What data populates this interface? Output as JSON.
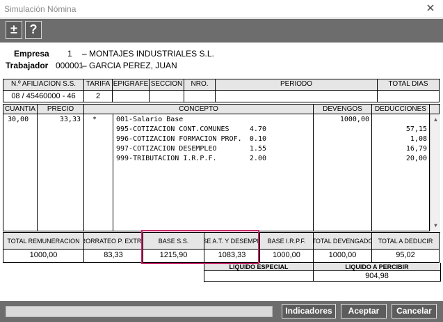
{
  "window": {
    "title": "Simulación Nómina",
    "close_glyph": "✕"
  },
  "toolbar": {
    "plusminus": "±",
    "help": "?"
  },
  "header": {
    "empresa_label": "Empresa",
    "empresa_code": "1",
    "empresa_name": "– MONTAJES INDUSTRIALES S.L.",
    "trabajador_label": "Trabajador",
    "trabajador_code": "000001",
    "trabajador_name": "– GARCIA PEREZ, JUAN"
  },
  "affiliation": {
    "headers": [
      "N.º AFILIACION S.S.",
      "TARIFA",
      "EPIGRAFE",
      "SECCION",
      "NRO.",
      "PERIODO",
      "TOTAL DIAS"
    ],
    "values": [
      "08 / 45460000 - 46",
      "2",
      "",
      "",
      "",
      "",
      ""
    ]
  },
  "lines": {
    "headers": {
      "cuantia": "CUANTIA",
      "precio": "PRECIO",
      "concepto": "CONCEPTO",
      "devengos": "DEVENGOS",
      "deducciones": "DEDUCCIONES"
    },
    "rows": [
      {
        "cuantia": "30,00",
        "precio": "33,33",
        "flag": "*",
        "concepto": "001-Salario Base",
        "pct": "",
        "devengos": "1000,00",
        "deducciones": ""
      },
      {
        "cuantia": "",
        "precio": "",
        "flag": "",
        "concepto": "995-COTIZACION CONT.COMUNES",
        "pct": "4.70",
        "devengos": "",
        "deducciones": "57,15"
      },
      {
        "cuantia": "",
        "precio": "",
        "flag": "",
        "concepto": "996-COTIZACION FORMACION PROF.",
        "pct": "0.10",
        "devengos": "",
        "deducciones": "1,08"
      },
      {
        "cuantia": "",
        "precio": "",
        "flag": "",
        "concepto": "997-COTIZACION DESEMPLEO",
        "pct": "1.55",
        "devengos": "",
        "deducciones": "16,79"
      },
      {
        "cuantia": "",
        "precio": "",
        "flag": "",
        "concepto": "999-TRIBUTACION I.R.P.F.",
        "pct": "2.00",
        "devengos": "",
        "deducciones": "20,00"
      }
    ]
  },
  "scrollbar": {
    "up": "▲",
    "down": "▼"
  },
  "totals": {
    "total_remuneracion_label": "TOTAL REMUNERACION",
    "prorrateo_label": "PRORRATEO P. EXTRAS",
    "base_ss_label": "BASE S.S.",
    "base_at_label": "BASE A.T. Y DESEMPLEO",
    "base_irpf_label": "BASE I.R.P.F.",
    "total_devengado_label": "TOTAL DEVENGADO",
    "total_deducir_label": "TOTAL A DEDUCIR",
    "total_remuneracion": "1000,00",
    "prorrateo": "83,33",
    "base_ss": "1215,90",
    "base_at": "1083,33",
    "base_irpf": "1000,00",
    "total_devengado": "1000,00",
    "total_deducir": "95,02",
    "liquido_especial_label": "LIQUIDO ESPECIAL",
    "liquido_percibir_label": "LIQUIDO A PERCIBIR",
    "liquido_especial": "",
    "liquido_percibir": "904,98"
  },
  "footer": {
    "indicadores": "Indicadores",
    "aceptar": "Aceptar",
    "cancelar": "Cancelar"
  }
}
